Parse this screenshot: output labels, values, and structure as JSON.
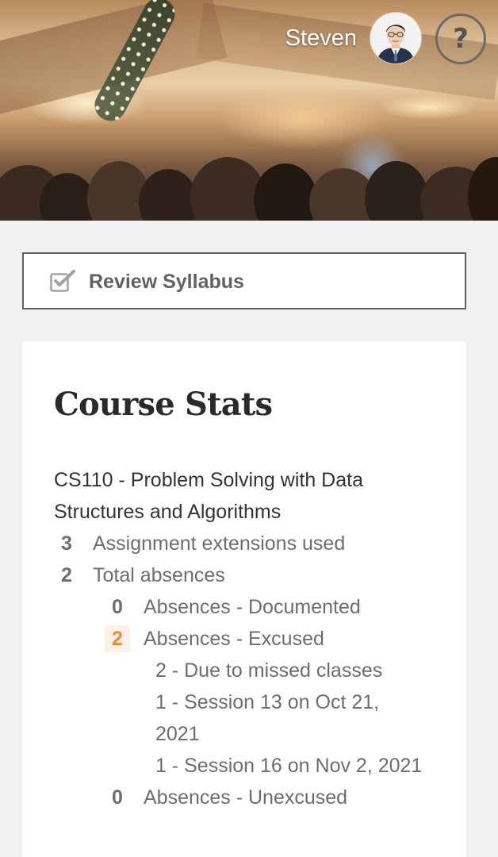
{
  "header": {
    "user_name": "Steven",
    "help_label": "?"
  },
  "syllabus_button": {
    "label": "Review Syllabus",
    "icon": "checkbox-icon"
  },
  "course_stats": {
    "title": "Course Stats",
    "course_name": "CS110 - Problem Solving with Data Structures and Algorithms",
    "extensions": {
      "count": "3",
      "label": "Assignment extensions used"
    },
    "total_absences": {
      "count": "2",
      "label": "Total absences"
    },
    "documented": {
      "count": "0",
      "label": "Absences - Documented"
    },
    "excused": {
      "count": "2",
      "label": "Absences - Excused",
      "details": [
        "2 - Due to missed classes",
        "1 - Session 13 on Oct 21,",
        "2021",
        "1 - Session 16 on Nov 2, 2021"
      ]
    },
    "unexcused": {
      "count": "0",
      "label": "Absences - Unexcused"
    }
  },
  "colors": {
    "accent_orange": "#ea8a3b",
    "highlight_bg": "#fdf0e6",
    "page_bg": "#f1f1f1"
  }
}
